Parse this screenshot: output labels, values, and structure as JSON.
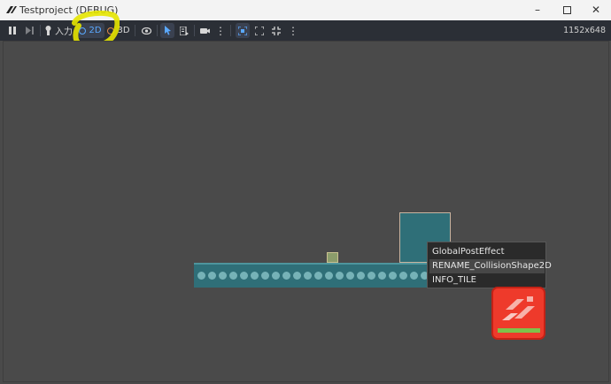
{
  "window": {
    "title": "Testproject (DEBUG)"
  },
  "toolbar": {
    "input_label": "入力",
    "mode_2d_label": "2D",
    "mode_3d_label": "3D",
    "resolution": "1152x648",
    "icons": [
      "pause-icon",
      "next-frame-icon",
      "input-icon",
      "2d-mode-icon",
      "3d-mode-icon",
      "visibility-icon",
      "select-icon",
      "list-icon",
      "camera-icon",
      "more-icon",
      "fit-icon",
      "expand-icon",
      "shrink-icon",
      "more-icon"
    ]
  },
  "popup": {
    "items": [
      "GlobalPostEffect",
      "RENAME_CollisionShape2D",
      "INFO_TILE"
    ],
    "selected_index": 1
  },
  "colors": {
    "viewport_bg": "#4a4a4a",
    "toolbar_bg": "#2b2f36",
    "accent_blue": "#5aa9ff",
    "tile_teal": "#2f6f78",
    "logo_red": "#ee3a2b",
    "highlight_yellow": "#e6e600"
  }
}
